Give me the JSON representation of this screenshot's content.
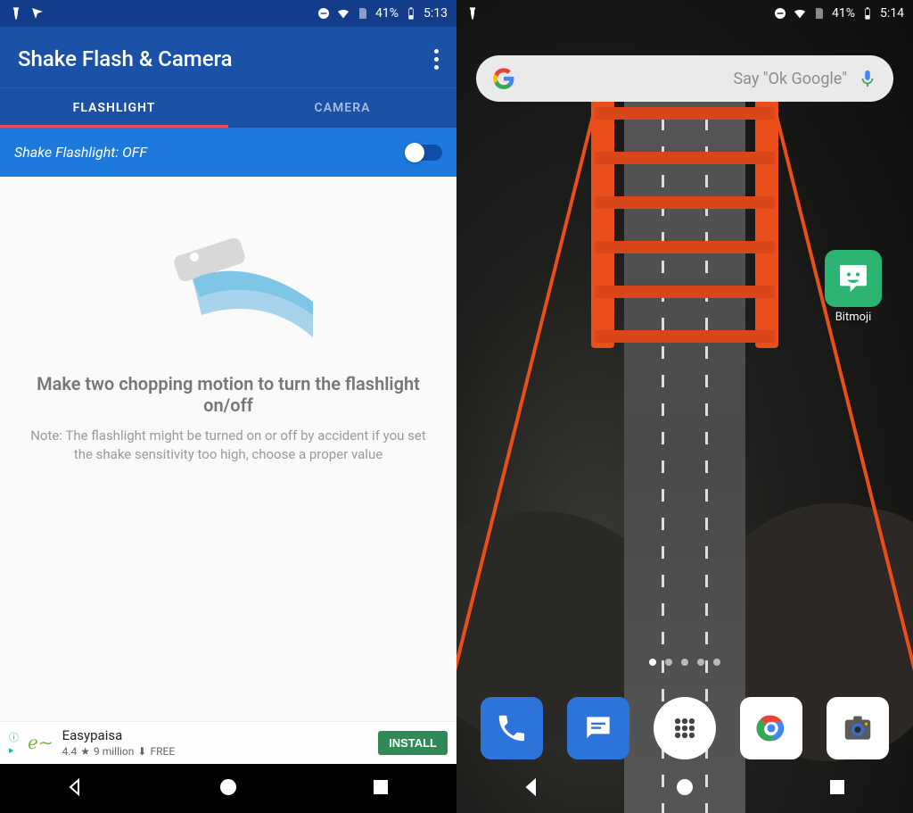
{
  "left": {
    "status": {
      "battery_pct": "41%",
      "time": "5:13"
    },
    "app_title": "Shake Flash & Camera",
    "tabs": {
      "flashlight": "FLASHLIGHT",
      "camera": "CAMERA"
    },
    "toggle_label": "Shake Flashlight: OFF",
    "instruction_headline": "Make two chopping motion to turn the flashlight on/off",
    "instruction_note": "Note: The flashlight might be turned on or off by accident if you set the shake sensitivity too high, choose a proper value",
    "ad": {
      "title": "Easypaisa",
      "rating": "4.4",
      "installs": "9 million",
      "price": "FREE",
      "button": "INSTALL"
    }
  },
  "right": {
    "status": {
      "battery_pct": "41%",
      "time": "5:14"
    },
    "search_hint": "Say \"Ok Google\"",
    "app_label": "Bitmoji"
  }
}
